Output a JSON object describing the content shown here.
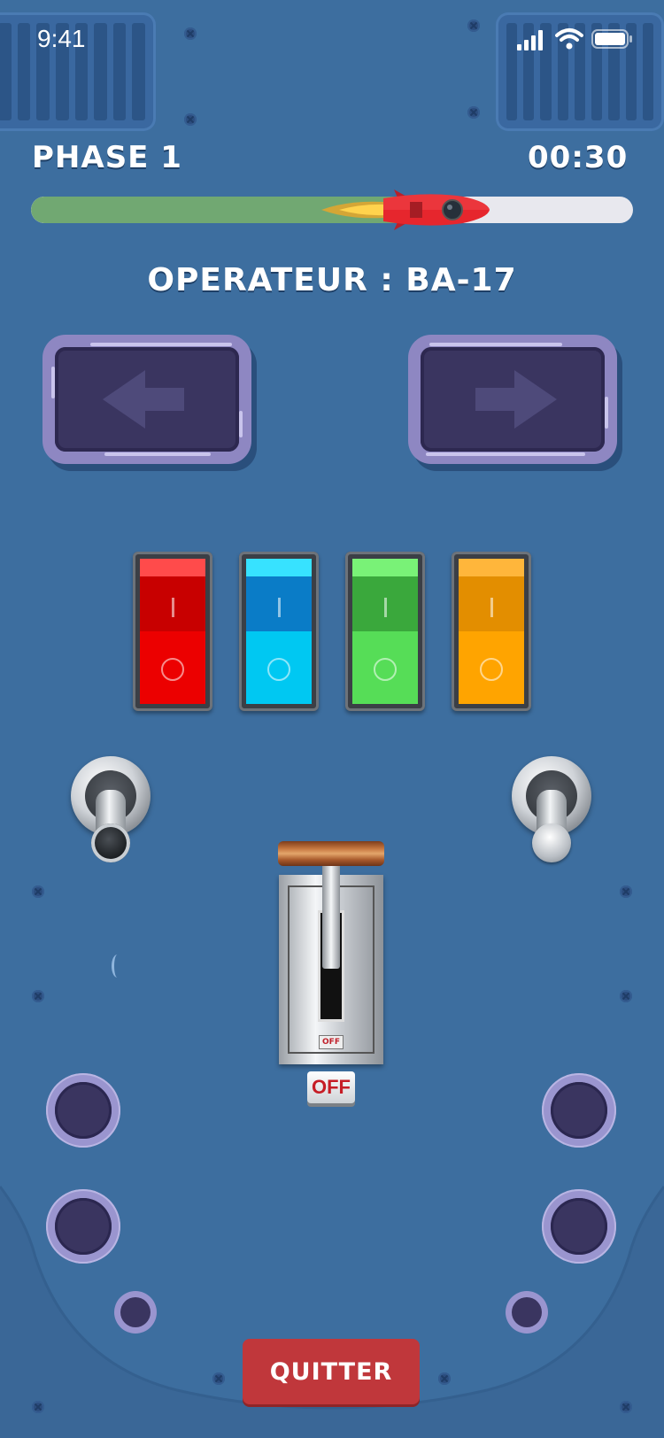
{
  "status_bar": {
    "time": "9:41",
    "signal_icon": "cellular-signal-icon",
    "wifi_icon": "wifi-icon",
    "battery_icon": "battery-icon"
  },
  "hud": {
    "phase": "PHASE 1",
    "timer": "00:30",
    "progress": 0.73,
    "rocket_icon": "rocket-icon"
  },
  "operator": "OPERATEUR : BA-17",
  "nav": {
    "left_icon": "arrow-left-icon",
    "right_icon": "arrow-right-icon"
  },
  "rocker_switches": [
    {
      "color": "red",
      "top": "#c80000",
      "cap": "#ff4b4b",
      "bottom": "#ec0000",
      "state": "O"
    },
    {
      "color": "blue",
      "top": "#0a7cc7",
      "cap": "#37e2ff",
      "bottom": "#00c8f2",
      "state": "O"
    },
    {
      "color": "green",
      "top": "#3aa83c",
      "cap": "#79f277",
      "bottom": "#56dd57",
      "state": "O"
    },
    {
      "color": "orange",
      "top": "#e38e00",
      "cap": "#ffb63b",
      "bottom": "#ffa400",
      "state": "O"
    }
  ],
  "throttle": {
    "plate_label": "OFF",
    "button_label": "OFF",
    "handle_color": "#a85a2c"
  },
  "quit_button": {
    "label": "QUITTER",
    "color": "#c0373b"
  },
  "colors": {
    "background": "#3d6e9f",
    "panel": "#8e87c2",
    "panel_inner": "#3a3560"
  }
}
